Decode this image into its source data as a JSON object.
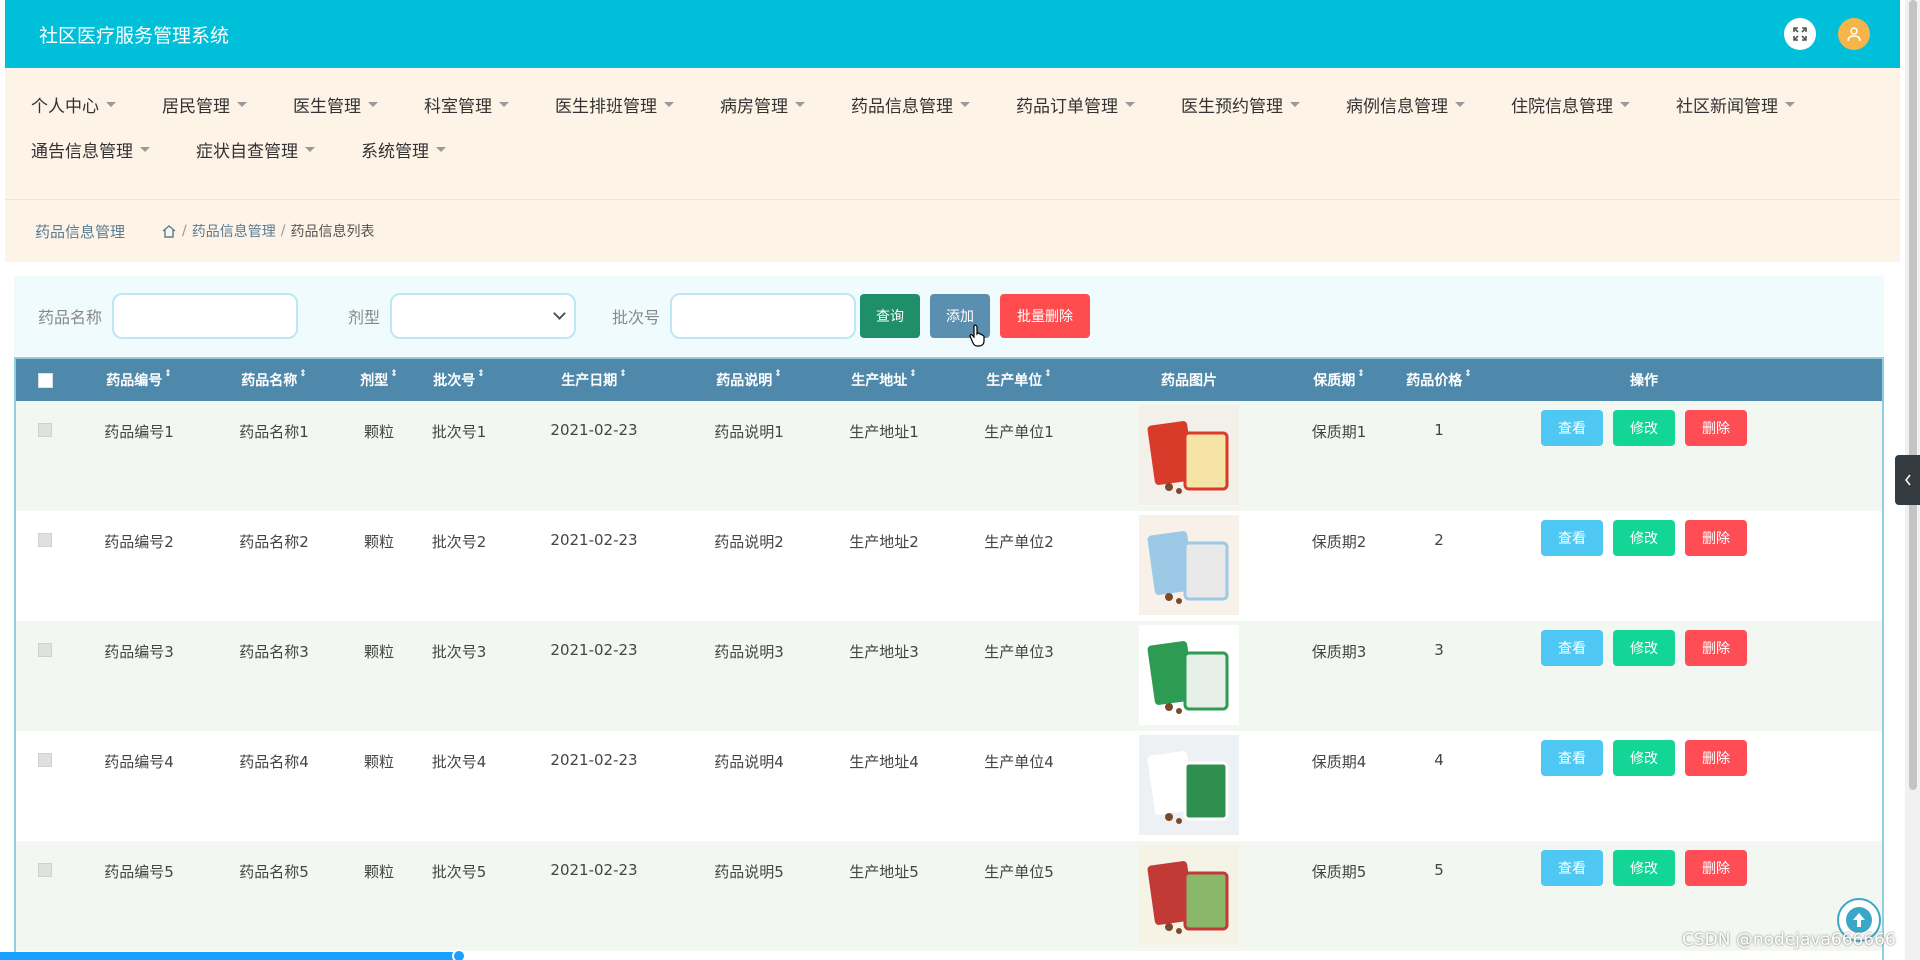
{
  "header": {
    "title": "社区医疗服务管理系统",
    "fullscreen_icon": "expand-icon",
    "user_icon": "user-icon",
    "accent": "#00bfd8"
  },
  "nav": {
    "row1": [
      "个人中心",
      "居民管理",
      "医生管理",
      "科室管理",
      "医生排班管理",
      "病房管理",
      "药品信息管理",
      "药品订单管理",
      "医生预约管理",
      "病例信息管理",
      "住院信息管理",
      "社区新闻管理"
    ],
    "row2": [
      "通告信息管理",
      "症状自查管理",
      "系统管理"
    ]
  },
  "breadcrumb": {
    "title": "药品信息管理",
    "sep": "/",
    "level1": "药品信息管理",
    "level2": "药品信息列表"
  },
  "search": {
    "name_label": "药品名称",
    "name_value": "",
    "type_label": "剂型",
    "type_value": "",
    "batch_label": "批次号",
    "batch_value": "",
    "query_btn": "查询",
    "add_btn": "添加",
    "batch_delete_btn": "批量删除"
  },
  "table": {
    "columns": [
      "药品编号",
      "药品名称",
      "剂型",
      "批次号",
      "生产日期",
      "药品说明",
      "生产地址",
      "生产单位",
      "药品图片",
      "保质期",
      "药品价格",
      "操作"
    ],
    "actions": {
      "view": "查看",
      "edit": "修改",
      "delete": "删除"
    },
    "rows": [
      {
        "code": "药品编号1",
        "name": "药品名称1",
        "type": "颗粒",
        "batch": "批次号1",
        "date": "2021-02-23",
        "desc": "药品说明1",
        "addr": "生产地址1",
        "unit": "生产单位1",
        "shelf": "保质期1",
        "price": "1"
      },
      {
        "code": "药品编号2",
        "name": "药品名称2",
        "type": "颗粒",
        "batch": "批次号2",
        "date": "2021-02-23",
        "desc": "药品说明2",
        "addr": "生产地址2",
        "unit": "生产单位2",
        "shelf": "保质期2",
        "price": "2"
      },
      {
        "code": "药品编号3",
        "name": "药品名称3",
        "type": "颗粒",
        "batch": "批次号3",
        "date": "2021-02-23",
        "desc": "药品说明3",
        "addr": "生产地址3",
        "unit": "生产单位3",
        "shelf": "保质期3",
        "price": "3"
      },
      {
        "code": "药品编号4",
        "name": "药品名称4",
        "type": "颗粒",
        "batch": "批次号4",
        "date": "2021-02-23",
        "desc": "药品说明4",
        "addr": "生产地址4",
        "unit": "生产单位4",
        "shelf": "保质期4",
        "price": "4"
      },
      {
        "code": "药品编号5",
        "name": "药品名称5",
        "type": "颗粒",
        "batch": "批次号5",
        "date": "2021-02-23",
        "desc": "药品说明5",
        "addr": "生产地址5",
        "unit": "生产单位5",
        "shelf": "保质期5",
        "price": "5"
      }
    ]
  },
  "watermark": "CSDN @nodejava666666"
}
